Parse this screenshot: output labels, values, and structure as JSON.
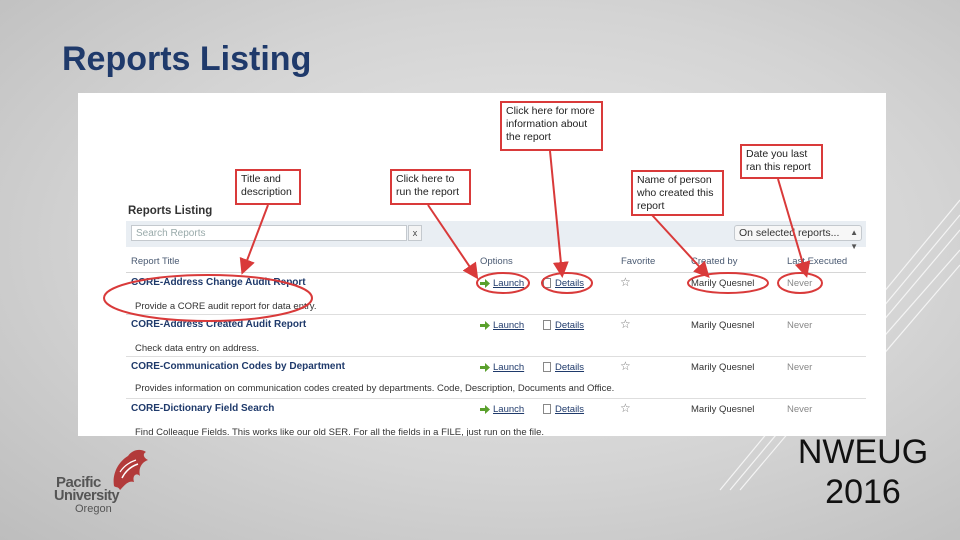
{
  "slide": {
    "title": "Reports Listing",
    "event_line1": "NWEUG",
    "event_line2": "2016"
  },
  "logo": {
    "line1": "Pacific",
    "line2": "University",
    "line3": "Oregon"
  },
  "app": {
    "heading": "Reports Listing",
    "search_placeholder": "Search Reports",
    "clear_label": "x",
    "filter_selected": "On selected reports...",
    "columns": {
      "title": "Report Title",
      "options": "Options",
      "favorite": "Favorite",
      "created_by": "Created by",
      "last_executed": "Last Executed"
    },
    "rows": [
      {
        "title": "CORE-Address Change Audit Report",
        "description": "Provide a CORE audit report for data entry.",
        "launch": "Launch",
        "details": "Details",
        "created_by": "Marily Quesnel",
        "last_executed": "Never"
      },
      {
        "title": "CORE-Address Created Audit Report",
        "description": "Check data entry on address.",
        "launch": "Launch",
        "details": "Details",
        "created_by": "Marily Quesnel",
        "last_executed": "Never"
      },
      {
        "title": "CORE-Communication Codes by Department",
        "description": "Provides information on communication codes created by departments. Code, Description, Documents and Office.",
        "launch": "Launch",
        "details": "Details",
        "created_by": "Marily Quesnel",
        "last_executed": "Never"
      },
      {
        "title": "CORE-Dictionary Field Search",
        "description": "Find Colleague Fields. This works like our old SER. For all the fields in a FILE, just run on the file.",
        "launch": "Launch",
        "details": "Details",
        "created_by": "Marily Quesnel",
        "last_executed": "Never"
      }
    ]
  },
  "callouts": {
    "title_desc": [
      "Title and",
      "description"
    ],
    "run": [
      "Click here to",
      "run the report"
    ],
    "more_info": [
      "Click here for more",
      "information about",
      "the report"
    ],
    "person": [
      "Name of person",
      "who created this",
      "report"
    ],
    "date": [
      "Date you last",
      "ran this report"
    ]
  },
  "colors": {
    "title_blue": "#1f3a6b",
    "callout_red": "#d93a3a",
    "launch_green": "#5aa02c"
  }
}
